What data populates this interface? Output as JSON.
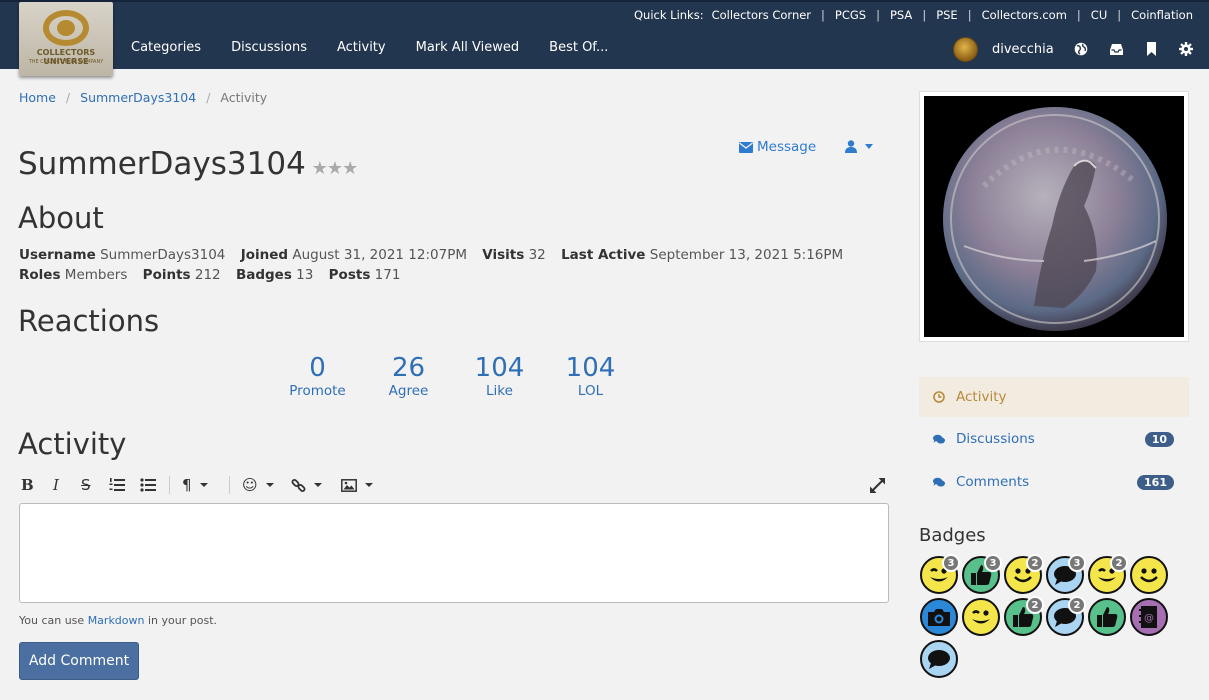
{
  "header": {
    "logo_text": "COLLECTORS UNIVERSE",
    "logo_subtext": "THE COLLECTIBLES COMPANY",
    "quick_links_label": "Quick Links:",
    "quick_links": [
      "Collectors Corner",
      "PCGS",
      "PSA",
      "PSE",
      "Collectors.com",
      "CU",
      "Coinflation"
    ],
    "nav": [
      "Categories",
      "Discussions",
      "Activity",
      "Mark All Viewed",
      "Best Of..."
    ],
    "username": "divecchia",
    "icons": [
      "globe-icon",
      "inbox-icon",
      "bookmark-icon",
      "gear-icon"
    ]
  },
  "breadcrumb": [
    "Home",
    "SummerDays3104",
    "Activity"
  ],
  "profile": {
    "name": "SummerDays3104",
    "stars": "★★★",
    "message_label": "Message",
    "about_heading": "About",
    "about": [
      {
        "label": "Username",
        "value": "SummerDays3104"
      },
      {
        "label": "Joined",
        "value": "August 31, 2021 12:07PM"
      },
      {
        "label": "Visits",
        "value": "32"
      },
      {
        "label": "Last Active",
        "value": "September 13, 2021 5:16PM"
      },
      {
        "label": "Roles",
        "value": "Members"
      },
      {
        "label": "Points",
        "value": "212"
      },
      {
        "label": "Badges",
        "value": "13"
      },
      {
        "label": "Posts",
        "value": "171"
      }
    ],
    "reactions_heading": "Reactions",
    "reactions": [
      {
        "count": "0",
        "label": "Promote"
      },
      {
        "count": "26",
        "label": "Agree"
      },
      {
        "count": "104",
        "label": "Like"
      },
      {
        "count": "104",
        "label": "LOL"
      }
    ],
    "activity_heading": "Activity"
  },
  "editor": {
    "markdown_note_prefix": "You can use ",
    "markdown_link": "Markdown",
    "markdown_note_suffix": " in your post.",
    "submit_label": "Add Comment"
  },
  "sidebar": {
    "items": [
      {
        "label": "Activity",
        "count": null,
        "active": true
      },
      {
        "label": "Discussions",
        "count": "10",
        "active": false
      },
      {
        "label": "Comments",
        "count": "161",
        "active": false
      }
    ],
    "badges_heading": "Badges",
    "badges": [
      {
        "type": "wink",
        "color": "yellow",
        "count": "3"
      },
      {
        "type": "thumb",
        "color": "green",
        "count": "3"
      },
      {
        "type": "smile",
        "color": "yellow",
        "count": "2"
      },
      {
        "type": "comment",
        "color": "blue",
        "count": "3"
      },
      {
        "type": "wink",
        "color": "yellow",
        "count": "2"
      },
      {
        "type": "smile",
        "color": "yellow",
        "count": null
      },
      {
        "type": "camera",
        "color": "camera",
        "count": null
      },
      {
        "type": "wink",
        "color": "yellow",
        "count": null
      },
      {
        "type": "thumb",
        "color": "green",
        "count": "2"
      },
      {
        "type": "comment",
        "color": "blue",
        "count": "2"
      },
      {
        "type": "thumb",
        "color": "green",
        "count": null
      },
      {
        "type": "address-book",
        "color": "purple",
        "count": null
      },
      {
        "type": "comment",
        "color": "blue",
        "count": null
      }
    ]
  }
}
